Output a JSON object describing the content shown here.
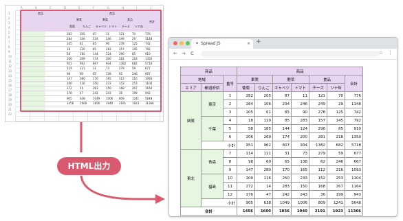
{
  "callout": {
    "label": "HTML出力"
  },
  "browser": {
    "tab_title": "Spread JS",
    "tab_icon": "spread-icon",
    "close_glyph": "×",
    "new_tab_glyph": "+",
    "back_glyph": "←",
    "forward_glyph": "→",
    "reload_glyph": "C",
    "star_glyph": "☆",
    "menu_glyph": "⋮",
    "traffic_colors": [
      "#ed6a5e",
      "#f4bf4f",
      "#61c554"
    ]
  },
  "report": {
    "h1": {
      "dim": "商品",
      "meas": "商品"
    },
    "h2": {
      "region": "地域",
      "no": "番号",
      "fruit": "果実",
      "veg": "野菜",
      "food": "食品",
      "total": "合計"
    },
    "h3": {
      "area": "エリア",
      "city": "都道府県",
      "items": [
        "葡萄",
        "りんご",
        "キャベツ",
        "トマト",
        "チーズ",
        "ツナ缶"
      ]
    },
    "groups": [
      {
        "area": "関東",
        "subtotal_label": "小計",
        "subtotal": [
          "951",
          "962",
          "807",
          "934",
          "1382",
          "682",
          "5718"
        ],
        "cities": [
          {
            "name": "東京",
            "rows": [
              {
                "no": "1",
                "v": [
                  "282",
                  "205",
                  "87",
                  "11",
                  "121",
                  "70",
                  "776"
                ]
              },
              {
                "no": "2",
                "v": [
                  "284",
                  "106",
                  "234",
                  "246",
                  "249",
                  "29",
                  "1148"
                ]
              },
              {
                "no": "3",
                "v": [
                  "105",
                  "61",
                  "85",
                  "90",
                  "278",
                  "125",
                  "742"
                ]
              }
            ]
          },
          {
            "name": "千葉",
            "rows": [
              {
                "no": "4",
                "v": [
                  "18",
                  "120",
                  "85",
                  "283",
                  "157",
                  "145",
                  "792"
                ]
              },
              {
                "no": "5",
                "v": [
                  "58",
                  "185",
                  "144",
                  "124",
                  "296",
                  "85",
                  "910"
                ]
              },
              {
                "no": "6",
                "v": [
                  "206",
                  "269",
                  "174",
                  "200",
                  "281",
                  "218",
                  "1350"
                ]
              }
            ]
          }
        ]
      },
      {
        "area": "東北",
        "subtotal_label": "小計",
        "subtotal": [
          "905",
          "638",
          "1049",
          "1006",
          "809",
          "1241",
          "5648"
        ],
        "cities": [
          {
            "name": "青森",
            "rows": [
              {
                "no": "7",
                "v": [
                  "114",
                  "121",
                  "31",
                  "73",
                  "279",
                  "59",
                  "677"
                ]
              },
              {
                "no": "8",
                "v": [
                  "98",
                  "60",
                  "65",
                  "138",
                  "62",
                  "246",
                  "667"
                ]
              },
              {
                "no": "9",
                "v": [
                  "147",
                  "280",
                  "170",
                  "165",
                  "112",
                  "216",
                  "1093"
                ]
              }
            ]
          },
          {
            "name": "福島",
            "rows": [
              {
                "no": "10",
                "v": [
                  "100",
                  "116",
                  "250",
                  "233",
                  "152",
                  "253",
                  "1104"
                ]
              },
              {
                "no": "11",
                "v": [
                  "272",
                  "14",
                  "283",
                  "150",
                  "168",
                  "267",
                  "1164"
                ]
              },
              {
                "no": "12",
                "v": [
                  "176",
                  "47",
                  "242",
                  "243",
                  "36",
                  "199",
                  "943"
                ]
              }
            ]
          }
        ]
      }
    ],
    "grand": {
      "label": "合計",
      "v": [
        "1456",
        "1600",
        "1856",
        "1940",
        "2191",
        "1923",
        "11366"
      ]
    }
  },
  "sheet_thumb": {
    "columns": [
      "A",
      "B",
      "C",
      "D",
      "E",
      "F",
      "G",
      "H",
      "I",
      "J",
      "K"
    ],
    "rows": [
      "1",
      "2",
      "3",
      "4",
      "5",
      "6",
      "7",
      "8",
      "9",
      "10",
      "11",
      "12",
      "13",
      "14",
      "15",
      "16",
      "17",
      "18",
      "19",
      "20",
      "21",
      "22"
    ]
  }
}
